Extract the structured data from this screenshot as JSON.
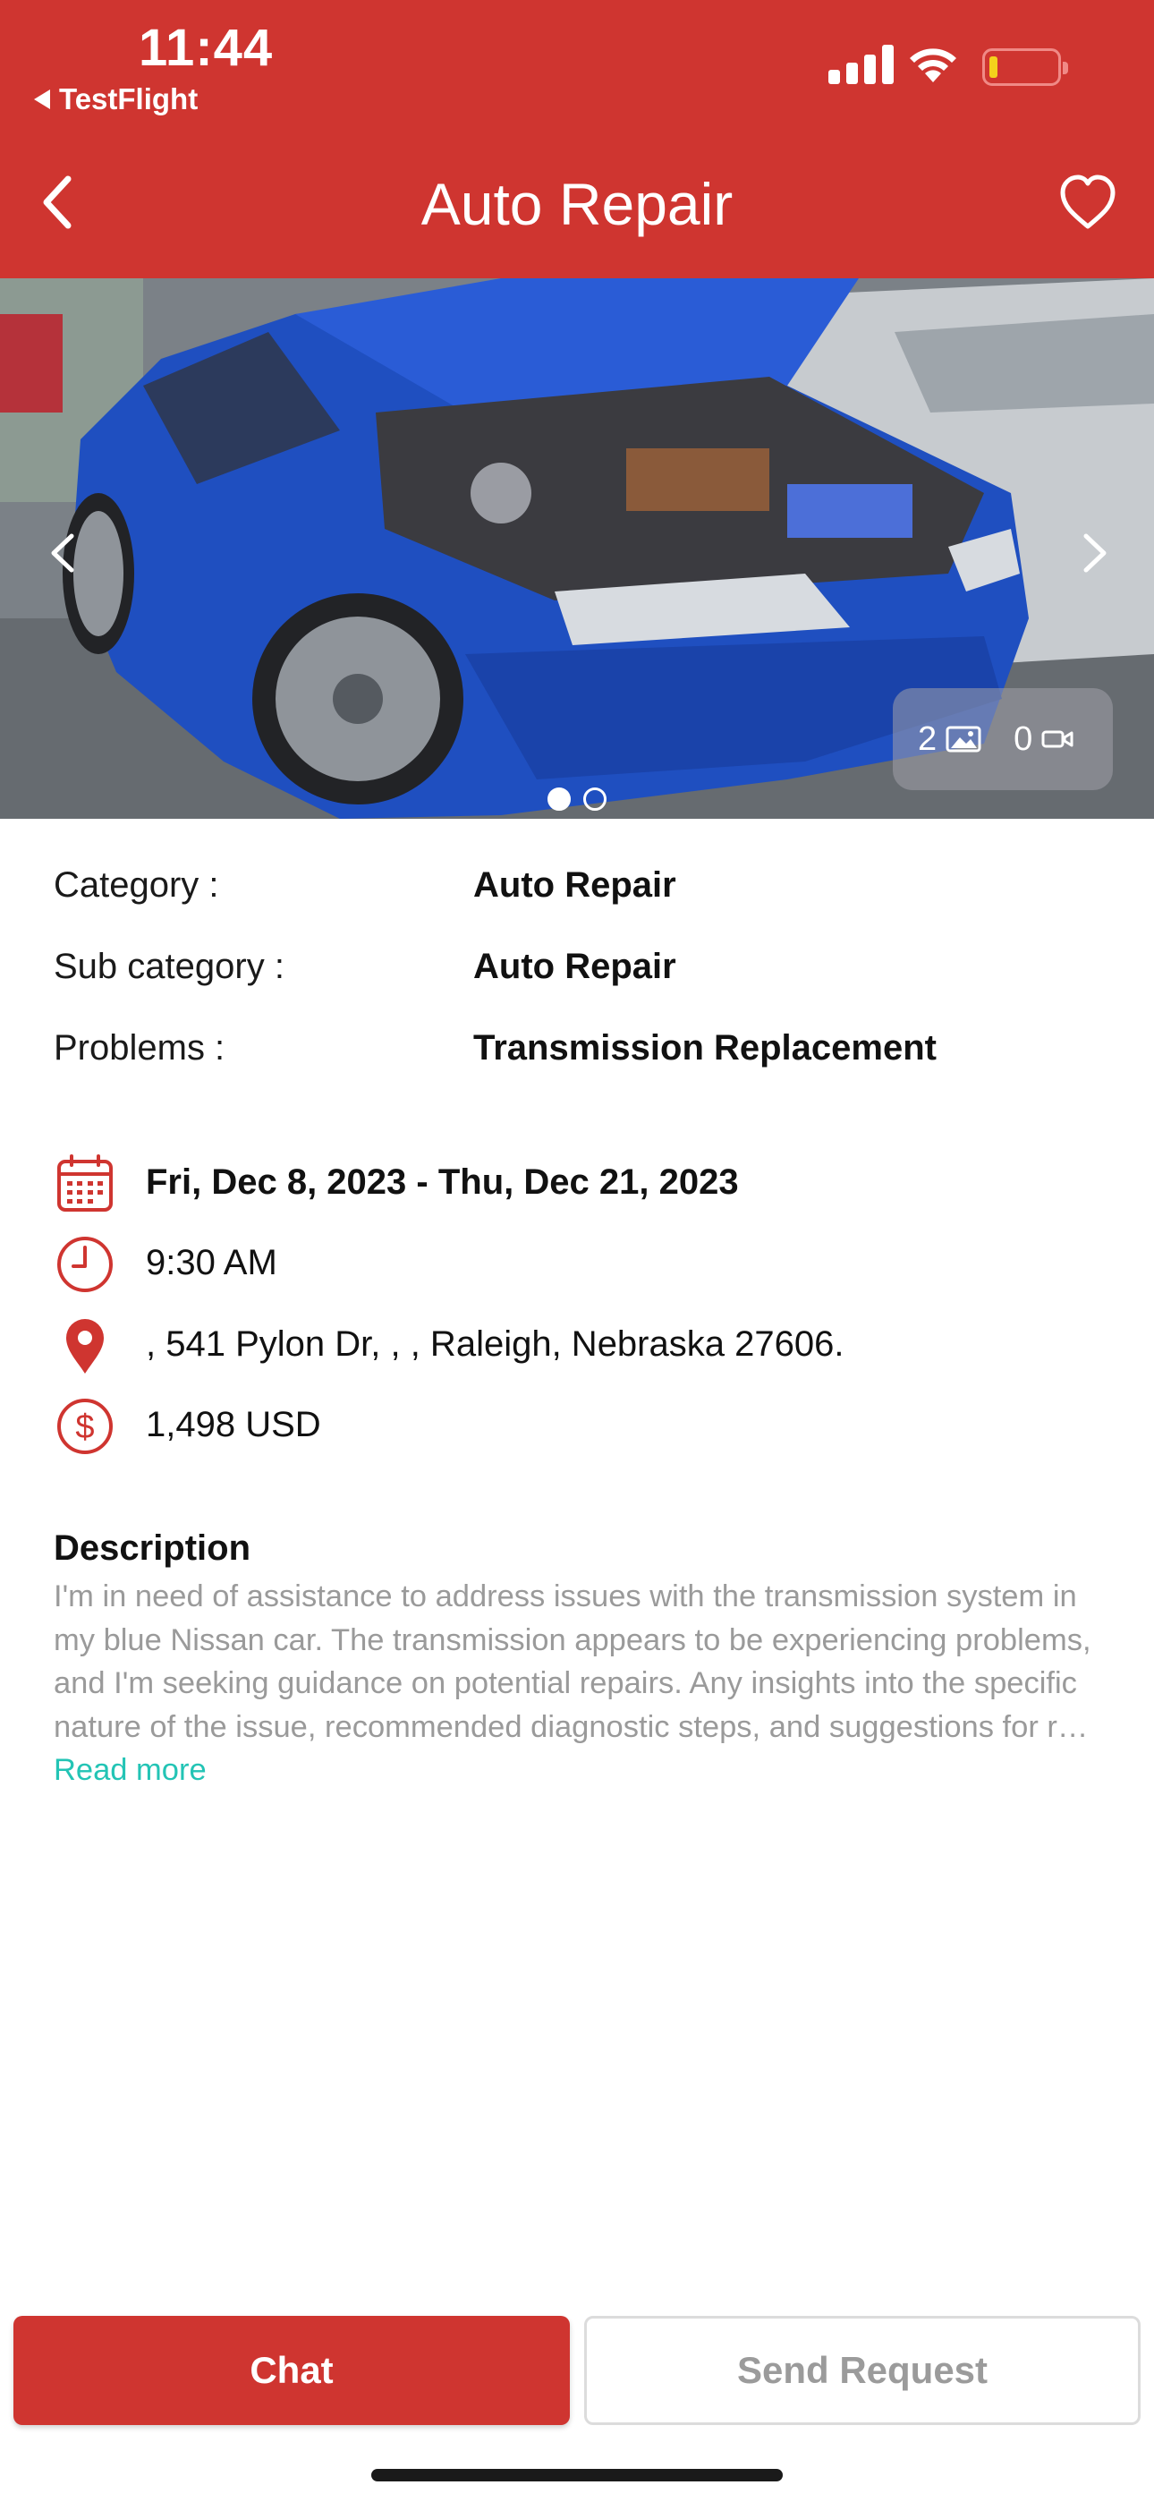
{
  "status_bar": {
    "time": "11:44",
    "back_app": "TestFlight"
  },
  "nav": {
    "title": "Auto Repair",
    "back_icon": "chevron-left-icon",
    "favorite_icon": "heart-outline-icon"
  },
  "gallery": {
    "photo_count": "2",
    "video_count": "0",
    "slides": 2,
    "active_slide": 1
  },
  "details": [
    {
      "label": "Category :",
      "value": "Auto Repair"
    },
    {
      "label": "Sub category :",
      "value": "Auto Repair"
    },
    {
      "label": "Problems :",
      "value": "Transmission Replacement"
    }
  ],
  "schedule": {
    "date_range": "Fri, Dec 8, 2023 - Thu, Dec 21, 2023",
    "time": "9:30 AM",
    "address": ", 541 Pylon Dr, , , Raleigh, Nebraska 27606.",
    "budget": "1,498 USD"
  },
  "description": {
    "title": "Description",
    "text": "I'm in need of assistance to address issues with the transmission system in my blue Nissan car. The transmission appears to be experiencing problems, and I'm seeking guidance on potential repairs. Any insights into the specific nature of the issue, recommended diagnostic steps, and suggestions for r…",
    "read_more": "Read more"
  },
  "actions": {
    "chat": "Chat",
    "send_request": "Send Request"
  },
  "colors": {
    "brand": "#cf3530",
    "link": "#23c4b5",
    "muted_text": "#9a9a9a"
  }
}
